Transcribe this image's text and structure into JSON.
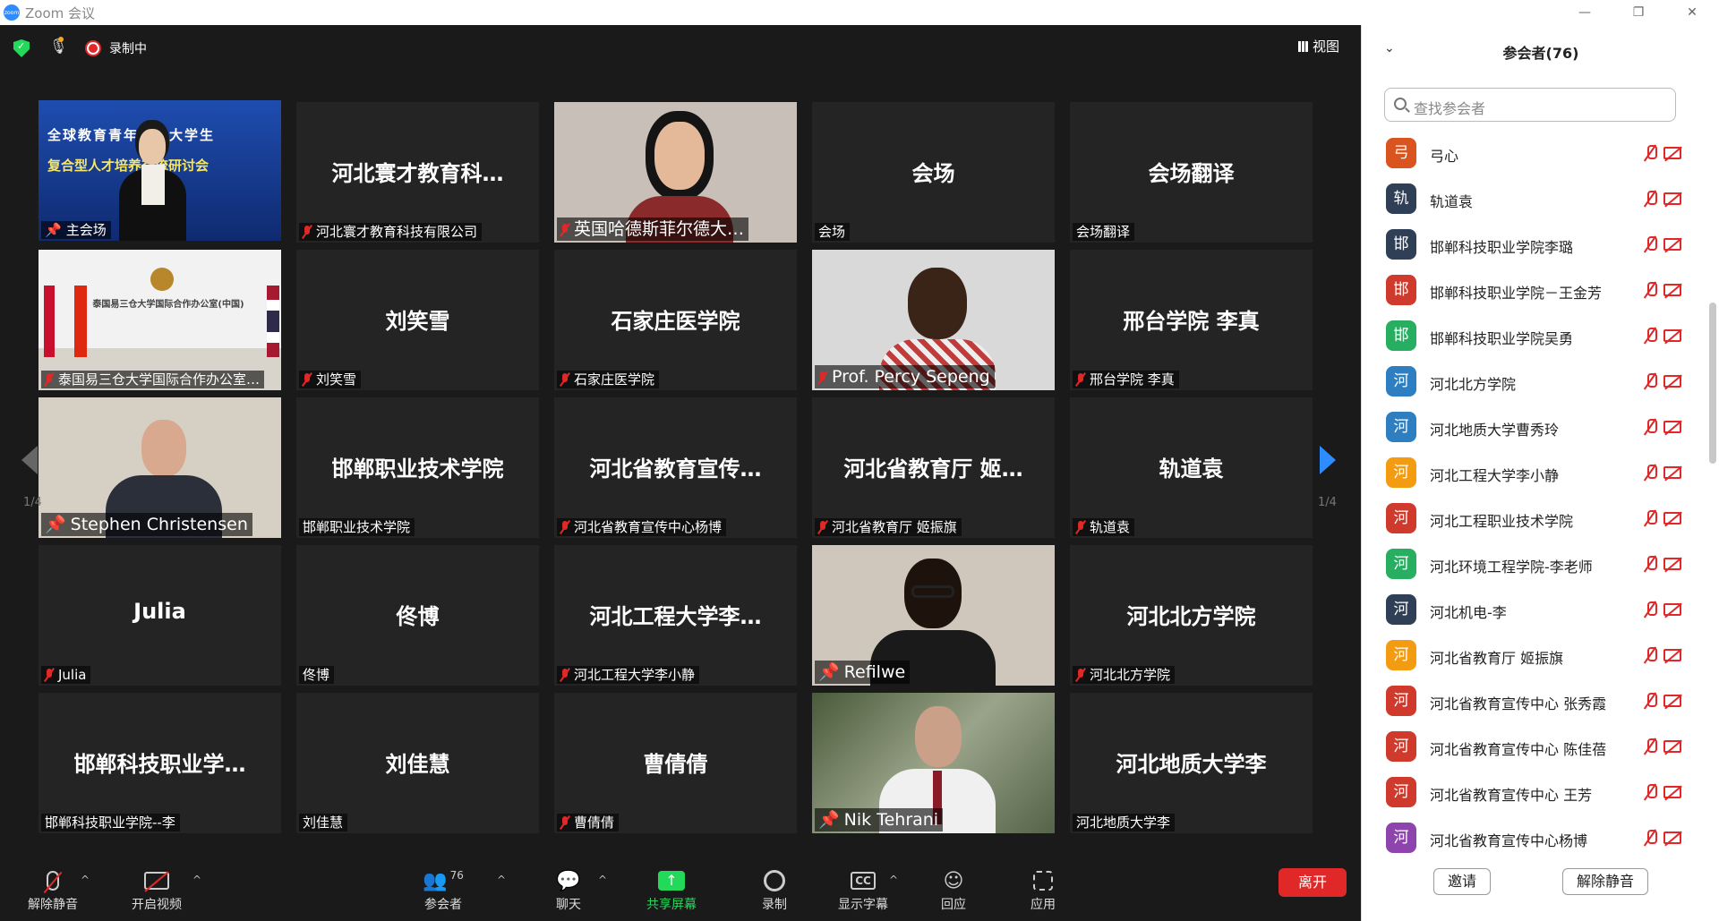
{
  "window": {
    "title": "Zoom 会议",
    "logo_text": "zoom",
    "minimize": "—",
    "maximize": "❐",
    "close": "✕"
  },
  "topbar": {
    "recording_label": "录制中",
    "view_label": "视图"
  },
  "pager": {
    "left": "1/4",
    "right": "1/4"
  },
  "tiles": {
    "t00": {
      "label": "主会场",
      "banner1": "全球教育青年未来大学生",
      "banner2": "复合型人才培养交流研讨会"
    },
    "t01": {
      "big": "河北寰才教育科…",
      "label": "河北寰才教育科技有限公司"
    },
    "t02": {
      "label": "英国哈德斯菲尔德大…"
    },
    "t03": {
      "big": "会场",
      "label": "会场"
    },
    "t04": {
      "big": "会场翻译",
      "label": "会场翻译"
    },
    "t10": {
      "label": "泰国易三仓大学国际合作办公室…",
      "sign": "泰国易三仓大学国际合作办公室(中国)"
    },
    "t11": {
      "big": "刘笑雪",
      "label": "刘笑雪"
    },
    "t12": {
      "big": "石家庄医学院",
      "label": "石家庄医学院"
    },
    "t13": {
      "label": "Prof. Percy Sepeng"
    },
    "t14": {
      "big": "邢台学院 李真",
      "label": "邢台学院 李真"
    },
    "t20": {
      "label": "Stephen Christensen"
    },
    "t21": {
      "big": "邯郸职业技术学院",
      "label": "邯郸职业技术学院"
    },
    "t22": {
      "big": "河北省教育宣传…",
      "label": "河北省教育宣传中心杨博"
    },
    "t23": {
      "big": "河北省教育厅 姬…",
      "label": "河北省教育厅 姬振旗"
    },
    "t24": {
      "big": "轨道袁",
      "label": "轨道袁"
    },
    "t30": {
      "big": "Julia",
      "label": "Julia"
    },
    "t31": {
      "big": "佟博",
      "label": "佟博"
    },
    "t32": {
      "big": "河北工程大学李…",
      "label": "河北工程大学李小静"
    },
    "t33": {
      "label": "Refilwe"
    },
    "t34": {
      "big": "河北北方学院",
      "label": "河北北方学院"
    },
    "t40": {
      "big": "邯郸科技职业学…",
      "label": "邯郸科技职业学院--李"
    },
    "t41": {
      "big": "刘佳慧",
      "label": "刘佳慧"
    },
    "t42": {
      "big": "曹倩倩",
      "label": "曹倩倩"
    },
    "t43": {
      "label": "Nik Tehrani"
    },
    "t44": {
      "big": "河北地质大学李",
      "label": "河北地质大学李"
    }
  },
  "toolbar": {
    "unmute": "解除静音",
    "start_video": "开启视频",
    "participants": "参会者",
    "participants_count": "76",
    "chat": "聊天",
    "share": "共享屏幕",
    "record": "录制",
    "captions": "显示字幕",
    "captions_icon": "CC",
    "reactions": "回应",
    "apps": "应用",
    "leave": "离开"
  },
  "panel": {
    "title": "参会者(76)",
    "search_placeholder": "查找参会者",
    "invite": "邀请",
    "unmute_all": "解除静音",
    "participants": [
      {
        "initial": "弓",
        "name": "弓心",
        "color": "#d9541e"
      },
      {
        "initial": "轨",
        "name": "轨道袁",
        "color": "#2f3f55"
      },
      {
        "initial": "邯",
        "name": "邯郸科技职业学院李璐",
        "color": "#2f3f55"
      },
      {
        "initial": "邯",
        "name": "邯郸科技职业学院－王金芳",
        "color": "#cf3a2d"
      },
      {
        "initial": "邯",
        "name": "邯郸科技职业学院吴勇",
        "color": "#27ae60"
      },
      {
        "initial": "河",
        "name": "河北北方学院",
        "color": "#2d7fc1"
      },
      {
        "initial": "河",
        "name": "河北地质大学曹秀玲",
        "color": "#2d7fc1"
      },
      {
        "initial": "河",
        "name": "河北工程大学李小静",
        "color": "#f39c12"
      },
      {
        "initial": "河",
        "name": "河北工程职业技术学院",
        "color": "#cf3a2d"
      },
      {
        "initial": "河",
        "name": "河北环境工程学院-李老师",
        "color": "#27ae60"
      },
      {
        "initial": "河",
        "name": "河北机电-李",
        "color": "#2f3f55"
      },
      {
        "initial": "河",
        "name": "河北省教育厅 姬振旗",
        "color": "#f39c12"
      },
      {
        "initial": "河",
        "name": "河北省教育宣传中心 张秀霞",
        "color": "#cf3a2d"
      },
      {
        "initial": "河",
        "name": "河北省教育宣传中心 陈佳蓓",
        "color": "#cf3a2d"
      },
      {
        "initial": "河",
        "name": "河北省教育宣传中心 王芳",
        "color": "#cf3a2d"
      },
      {
        "initial": "河",
        "name": "河北省教育宣传中心杨博",
        "color": "#8e44ad"
      }
    ]
  }
}
